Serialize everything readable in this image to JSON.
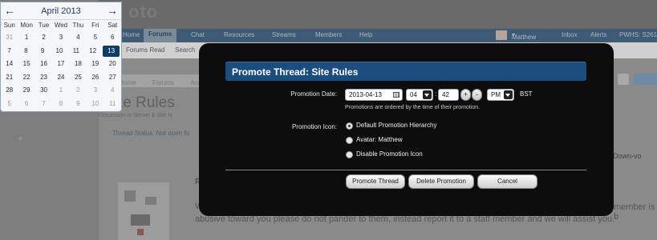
{
  "background": {
    "logo": "oto",
    "nav": [
      "Home",
      "Forums",
      "Chat",
      "Resources",
      "Streams",
      "Members",
      "Help"
    ],
    "user": "Matthew",
    "user_links": [
      "Inbox",
      "Alerts",
      "PWHS: S261"
    ],
    "subnav": [
      "Forums Read",
      "Search"
    ],
    "breadcrumbs": [
      "Home",
      "Forums",
      "Ann"
    ],
    "thread_title": "te Rules",
    "discussion_text": "Discussion in Server & Site N",
    "thread_status": "Thread Status: Not open fo",
    "vote_label": "Down-vo",
    "post_initial": "R",
    "post_w": "W",
    "member_text": "member is b",
    "abusive_text": "abusive toward you please do not pander to them, instead report it to a staff member and we will assist you."
  },
  "calendar": {
    "prev_label": "←",
    "next_label": "→",
    "month_label": "April 2013",
    "weekdays": [
      "Sun",
      "Mon",
      "Tue",
      "Wed",
      "Thu",
      "Fri",
      "Sat"
    ],
    "weeks": [
      [
        "31",
        "1",
        "2",
        "3",
        "4",
        "5",
        "6"
      ],
      [
        "7",
        "8",
        "9",
        "10",
        "11",
        "12",
        "13"
      ],
      [
        "14",
        "15",
        "16",
        "17",
        "18",
        "19",
        "20"
      ],
      [
        "21",
        "22",
        "23",
        "24",
        "25",
        "26",
        "27"
      ],
      [
        "28",
        "29",
        "30",
        "1",
        "2",
        "3",
        "4"
      ],
      [
        "5",
        "6",
        "7",
        "8",
        "9",
        "10",
        "11"
      ]
    ],
    "selected": "13"
  },
  "modal": {
    "title": "Promote Thread: Site Rules",
    "date_label": "Promotion Date:",
    "date_value": "2013-04-13",
    "hour": "04",
    "minute": "42",
    "step_up": "+",
    "step_down": "-",
    "ampm": "PM",
    "timezone": "BST",
    "hint": "Promotions are ordered by the time of their promotion.",
    "icon_label": "Promotion Icon:",
    "icon_options": [
      "Default Promotion Hierarchy",
      "Avatar: Matthew",
      "Disable Promotion Icon"
    ],
    "selected_icon": "Default Promotion Hierarchy",
    "buttons": {
      "promote": "Promote Thread",
      "delete": "Delete Promotion",
      "cancel": "Cancel"
    }
  }
}
